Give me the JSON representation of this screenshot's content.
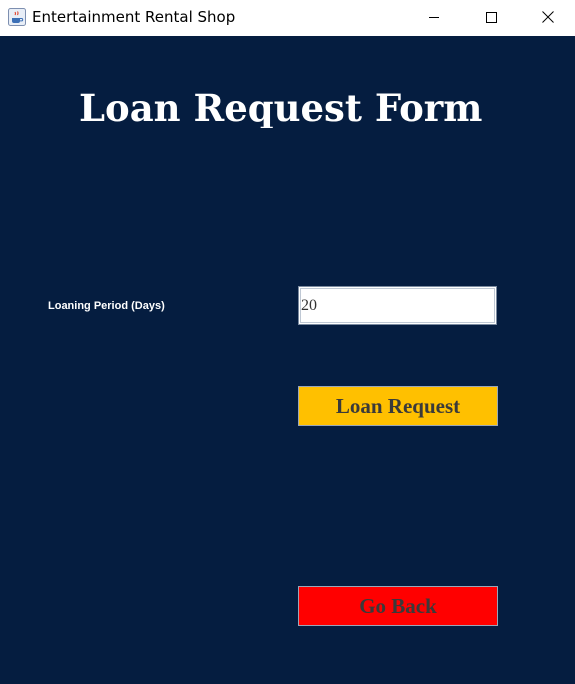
{
  "window": {
    "title": "Entertainment Rental Shop",
    "icon": "java-coffee-cup-icon",
    "controls": [
      "minimize-icon",
      "maximize-icon",
      "close-icon"
    ]
  },
  "colors": {
    "background": "#051d40",
    "loan_button": "#ffc000",
    "back_button": "#ff0000",
    "title_text": "#ffffff"
  },
  "form": {
    "title": "Loan Request Form",
    "period_label": "Loaning Period (Days)",
    "period_value": "20",
    "loan_request_label": "Loan Request",
    "go_back_label": "Go Back"
  }
}
